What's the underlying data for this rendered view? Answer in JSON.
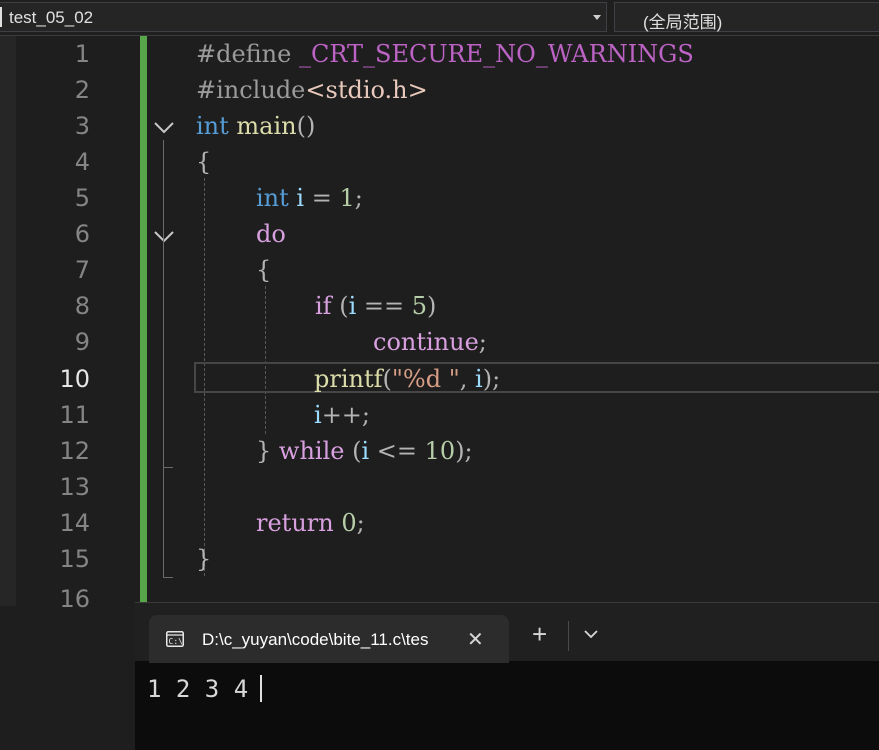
{
  "navbar": {
    "project": "test_05_02",
    "scope": "(全局范围)"
  },
  "editor": {
    "current_line": 10,
    "line_numbers": [
      "1",
      "2",
      "3",
      "4",
      "5",
      "6",
      "7",
      "8",
      "9",
      "10",
      "11",
      "12",
      "13",
      "14",
      "15",
      "16"
    ],
    "code": {
      "l1": [
        "#define",
        " ",
        "_CRT_SECURE_NO_WARNINGS"
      ],
      "l2": [
        "#include",
        "<stdio.h>"
      ],
      "l3": [
        "int",
        " ",
        "main",
        "()"
      ],
      "l4": [
        "{"
      ],
      "l5": [
        "int",
        " ",
        "i",
        " = ",
        "1",
        ";"
      ],
      "l6": [
        "do"
      ],
      "l7": [
        "{"
      ],
      "l8": [
        "if",
        " (",
        "i",
        " == ",
        "5",
        ")"
      ],
      "l9": [
        "continue",
        ";"
      ],
      "l10": [
        "printf",
        "(",
        "\"%d \"",
        ", ",
        "i",
        ");"
      ],
      "l11": [
        "i",
        "++;"
      ],
      "l12": [
        "} ",
        "while",
        " (",
        "i",
        " <= ",
        "10",
        ");"
      ],
      "l14": [
        "return",
        " ",
        "0",
        ";"
      ],
      "l15": [
        "}"
      ]
    }
  },
  "terminal": {
    "tab_title": "D:\\c_yuyan\\code\\bite_11.c\\tes",
    "close_glyph": "✕",
    "new_tab_glyph": "+",
    "output": "1 2 3 4 "
  },
  "colors": {
    "change_bar": "#57a64a",
    "keyword": "#569cd6",
    "control": "#d8a0df",
    "function": "#dcdcaa",
    "variable": "#9cdcfe",
    "number": "#b5cea8",
    "string": "#d69d85"
  },
  "icons": [
    "chevron-down-icon",
    "fold-toggle-icon",
    "terminal-icon",
    "close-icon",
    "plus-icon"
  ]
}
